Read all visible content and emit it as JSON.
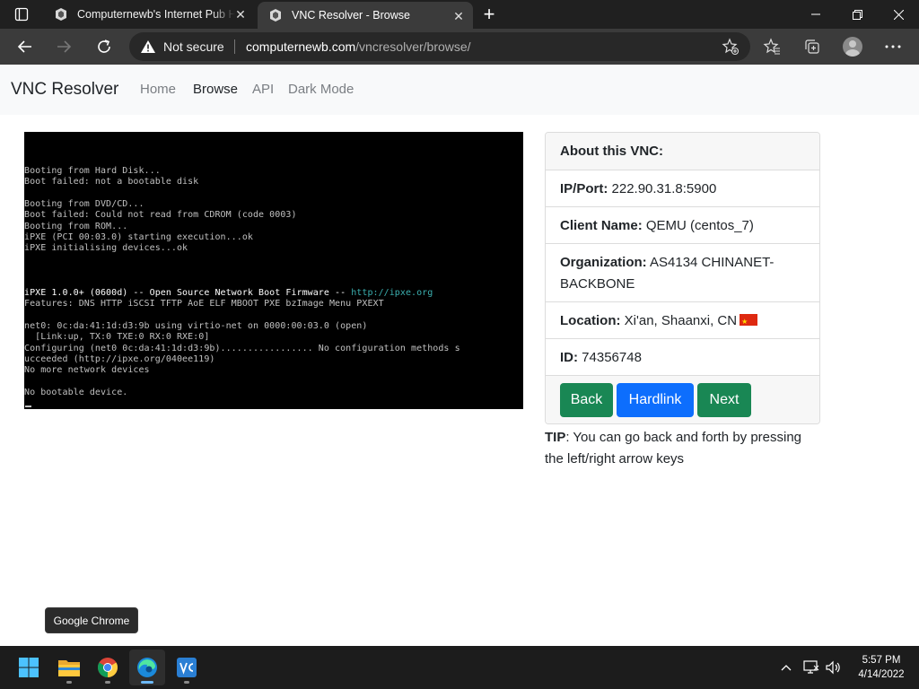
{
  "browser": {
    "tabs": [
      {
        "title": "Computernewb's Internet Pub Hub",
        "favicon": "computernewb-icon",
        "active": false
      },
      {
        "title": "VNC Resolver - Browse",
        "favicon": "computernewb-icon",
        "active": true
      }
    ],
    "address": {
      "security_label": "Not secure",
      "url_host": "computernewb.com",
      "url_path": "/vncresolver/browse/"
    }
  },
  "site": {
    "brand": "VNC Resolver",
    "nav": {
      "home": "Home",
      "browse": "Browse",
      "api": "API",
      "dark_mode": "Dark Mode"
    }
  },
  "vnc_screen": {
    "lines": [
      "Booting from Hard Disk...",
      "Boot failed: not a bootable disk",
      "",
      "Booting from DVD/CD...",
      "Boot failed: Could not read from CDROM (code 0003)",
      "Booting from ROM...",
      "iPXE (PCI 00:03.0) starting execution...ok",
      "iPXE initialising devices...ok",
      "",
      "",
      "",
      "iPXE 1.0.0+ (0600d) -- Open Source Network Boot Firmware -- ",
      "Features: DNS HTTP iSCSI TFTP AoE ELF MBOOT PXE bzImage Menu PXEXT",
      "",
      "net0: 0c:da:41:1d:d3:9b using virtio-net on 0000:00:03.0 (open)",
      "  [Link:up, TX:0 TXE:0 RX:0 RXE:0]",
      "Configuring (net0 0c:da:41:1d:d3:9b)................. No configuration methods s",
      "ucceeded (http://ipxe.org/040ee119)",
      "No more network devices",
      "",
      "No bootable device."
    ],
    "ipxe_link": "http://ipxe.org"
  },
  "card": {
    "header": "About this VNC:",
    "ip_label": "IP/Port:",
    "ip_value": "222.90.31.8:5900",
    "client_label": "Client Name:",
    "client_value": "QEMU (centos_7)",
    "org_label": "Organization:",
    "org_value": "AS4134 CHINANET-BACKBONE",
    "location_label": "Location:",
    "location_value": "Xi'an, Shaanxi, CN",
    "location_flag": "china-flag-icon",
    "id_label": "ID:",
    "id_value": "74356748",
    "buttons": {
      "back": "Back",
      "hardlink": "Hardlink",
      "next": "Next"
    },
    "colors": {
      "success": "#198754",
      "primary": "#0d6efd"
    }
  },
  "tip": {
    "label": "TIP",
    "text": ": You can go back and forth by pressing the left/right arrow keys"
  },
  "tooltip": "Google Chrome",
  "taskbar": {
    "apps": [
      "start-icon",
      "file-explorer-icon",
      "chrome-icon",
      "edge-icon",
      "vnc-viewer-icon"
    ],
    "time": "5:57 PM",
    "date": "4/14/2022"
  }
}
